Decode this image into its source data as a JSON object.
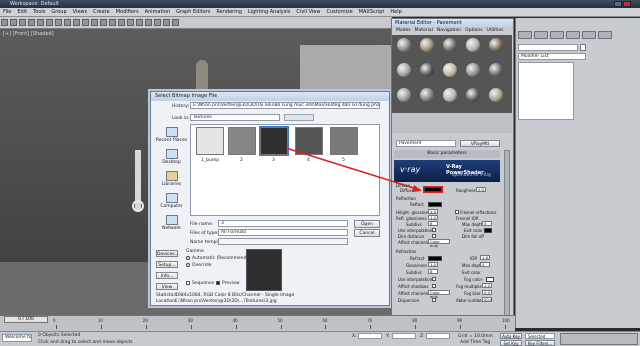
{
  "window": {
    "title": "Workspace: Default"
  },
  "menu": [
    "File",
    "Edit",
    "Tools",
    "Group",
    "Views",
    "Create",
    "Modifiers",
    "Animation",
    "Graph Editors",
    "Rendering",
    "Lighting Analysis",
    "Civil View",
    "Customize",
    "MAXScript",
    "Help"
  ],
  "viewport": {
    "label": "[+] [Front] [Shaded]"
  },
  "dialog": {
    "title": "Select Bitmap Image File",
    "history_label": "History:",
    "history_value": "E:\\Nhan pro\\Vertex\\@3D\\3D\\Tài liệu\\Bổ sung mục 3ds\\Max\\Hướng dẫn sử dụng phần mềm 3ds Max\\Textures",
    "lookin_label": "Look in:",
    "lookin_value": "Textures",
    "sidebar": [
      "Recent Places",
      "Desktop",
      "Libraries",
      "Computer",
      "Network"
    ],
    "thumbs": [
      {
        "label": "1_bump",
        "color": "#e6e6e6"
      },
      {
        "label": "2",
        "color": "#858585"
      },
      {
        "label": "3",
        "color": "#2f2f2f"
      },
      {
        "label": "4",
        "color": "#555555"
      },
      {
        "label": "5",
        "color": "#7a7a7a"
      }
    ],
    "filename_label": "File name:",
    "filename_value": "3",
    "filetype_label": "Files of type:",
    "filetype_value": "All Formats",
    "template_label": "Name template:",
    "open_label": "Open",
    "cancel_label": "Cancel",
    "devices_label": "Devices...",
    "setup_label": "Setup...",
    "info_label": "Info...",
    "view_label": "View",
    "gamma_label": "Gamma",
    "gamma_auto": "Automatic (Recommended)",
    "gamma_override": "Override",
    "sequence_label": "Sequence",
    "preview_label": "Preview",
    "stats_label": "Statistics:",
    "stats_value": "1084x1084, RGB Color 8 Bits/Channel - Single Image",
    "location_label": "Location:",
    "location_value": "E:\\Nhan pro\\Vertex\\@3D\\3D\\...\\Textures\\3.jpg"
  },
  "material_editor": {
    "title": "Material Editor - Pavement",
    "menu": [
      "Modes",
      "Material",
      "Navigation",
      "Options",
      "Utilities"
    ],
    "name_value": "Pavement",
    "type_value": "VRayMtl",
    "rollout": "Basic parameters",
    "banner_logo": "v·ray",
    "banner_title": "V-Ray PowerShader",
    "banner_sub": "optimized for V-Ray",
    "diffuse_section": "Diffuse",
    "diffuse_label": "Diffuse",
    "roughness_label": "Roughness",
    "roughness_value": "0.0",
    "reflection_section": "Reflection",
    "reflect_label": "Reflect",
    "hilight_label": "Hilight. glossiness",
    "hilight_value": "1.0",
    "refl_gloss_label": "Refl. glossiness",
    "refl_gloss_value": "1.0",
    "subdivs_label": "Subdivs",
    "subdivs_value": "8",
    "use_interp_label": "Use interpolation",
    "dim_distance_label": "Dim distance",
    "affect_channels_label": "Affect channels",
    "affect_channels_value": "Color only",
    "fresnel_label": "Fresnel reflections",
    "fresnel_ior_label": "Fresnel IOR",
    "max_depth_label": "Max depth",
    "max_depth_value": "5",
    "exit_color_label": "Exit color",
    "dim_falloff_label": "Dim fall off",
    "refraction_section": "Refraction",
    "refract_label": "Refract",
    "glossiness_label": "Glossiness",
    "glossiness_value": "1.0",
    "ior_label": "IOR",
    "ior_value": "1.6",
    "fog_color_label": "Fog color",
    "fog_mult_label": "Fog multiplier",
    "fog_mult_value": "1.0",
    "fog_bias_label": "Fog bias",
    "fog_bias_value": "0.0",
    "affect_shadows_label": "Affect shadows",
    "dispersion_label": "Dispersion",
    "abbe_label": "Abbe number",
    "abbe_value": "50.0"
  },
  "command_panel": {
    "modifier_list": "Modifier List"
  },
  "timeline": {
    "frame": "0 / 100",
    "ticks": [
      "0",
      "10",
      "20",
      "30",
      "40",
      "50",
      "60",
      "70",
      "80",
      "90",
      "100"
    ]
  },
  "status": {
    "welcome": "Welcome to M",
    "selected": "0 Objects Selected",
    "prompt": "Click and drag to select and move objects",
    "x_label": "X:",
    "y_label": "Y:",
    "z_label": "Z:",
    "grid": "Grid = 10.0mm",
    "autokey": "Auto Key",
    "selected_dd": "Selected",
    "set_key": "Set Key",
    "key_filters": "Key Filters...",
    "add_time_tag": "Add Time Tag"
  },
  "colors": {
    "accent": "#e02020",
    "vray_banner": "#1f3f7a"
  }
}
